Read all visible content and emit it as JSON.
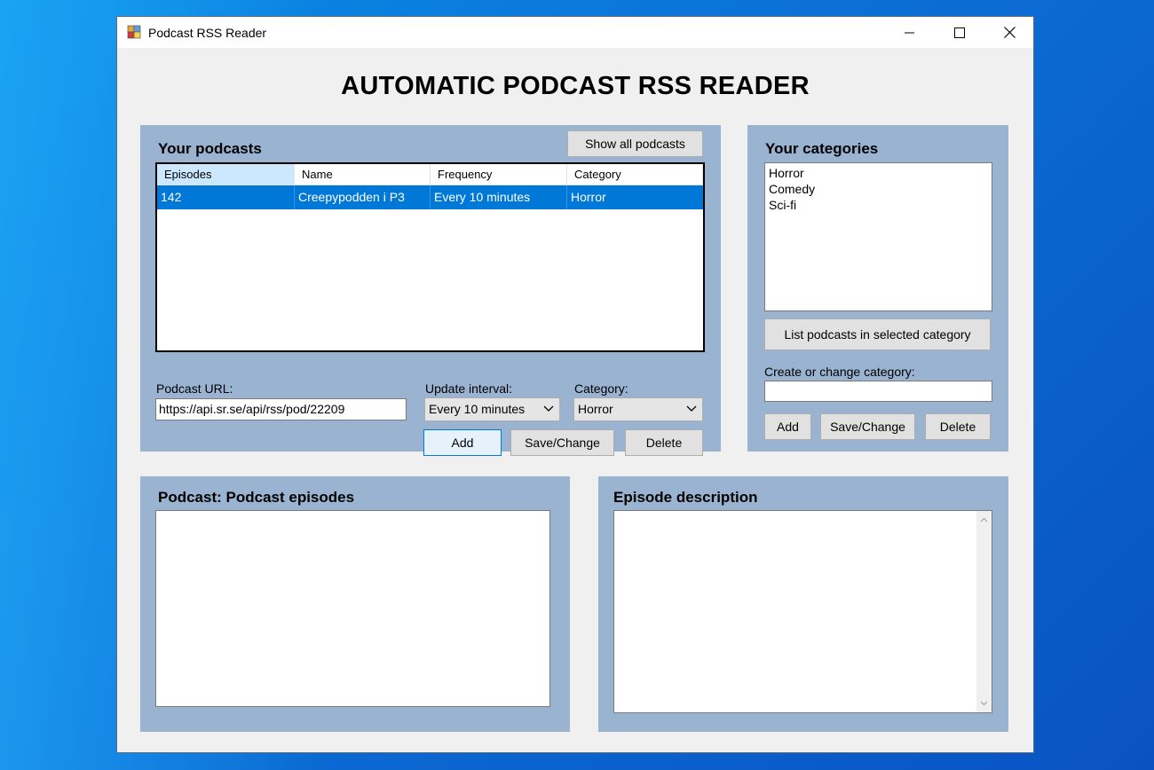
{
  "window": {
    "title": "Podcast RSS Reader"
  },
  "main_title": "AUTOMATIC PODCAST RSS READER",
  "podcasts_panel": {
    "title": "Your podcasts",
    "show_all_label": "Show all podcasts",
    "columns": [
      "Episodes",
      "Name",
      "Frequency",
      "Category"
    ],
    "rows": [
      {
        "episodes": "142",
        "name": "Creepypodden i P3",
        "frequency": "Every 10 minutes",
        "category": "Horror"
      }
    ],
    "url_label": "Podcast URL:",
    "url_value": "https://api.sr.se/api/rss/pod/22209",
    "interval_label": "Update interval:",
    "interval_value": "Every 10 minutes",
    "category_label": "Category:",
    "category_value": "Horror",
    "add_label": "Add",
    "save_label": "Save/Change",
    "delete_label": "Delete"
  },
  "categories_panel": {
    "title": "Your categories",
    "items": [
      "Horror",
      "Comedy",
      "Sci-fi"
    ],
    "list_button_label": "List podcasts in selected category",
    "field_label": "Create or change category:",
    "field_value": "",
    "add_label": "Add",
    "save_label": "Save/Change",
    "delete_label": "Delete"
  },
  "episodes_panel": {
    "title": "Podcast: Podcast episodes"
  },
  "description_panel": {
    "title": "Episode description"
  },
  "icons": [
    "app-icon",
    "minimize-icon",
    "maximize-icon",
    "close-icon",
    "chevron-down-icon",
    "scroll-up-icon",
    "scroll-down-icon"
  ],
  "colors": {
    "panel": "#9ab3d1",
    "selection": "#0078d7",
    "window": "#f0f0f0"
  }
}
